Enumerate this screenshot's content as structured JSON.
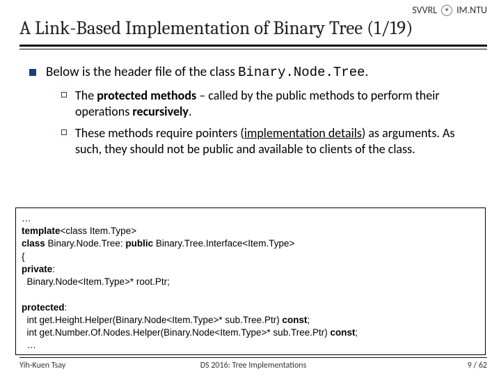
{
  "header": {
    "org_left": "SVVRL",
    "org_sep": "@",
    "org_right": "IM.NTU",
    "title": "A Link-Based Implementation of Binary Tree (1/19)"
  },
  "body": {
    "lvl1_pre": "Below is the header file of the class ",
    "lvl1_code": "Binary.Node.Tree",
    "lvl1_post": ".",
    "sub1_a": "The ",
    "sub1_b": "protected methods",
    "sub1_c": " – called by the public methods to perform their operations ",
    "sub1_d": "recursively",
    "sub1_e": ".",
    "sub2_a": "These methods require pointers (",
    "sub2_b": "implementation details",
    "sub2_c": ") as arguments. As such, they should not be public and available to clients of the class."
  },
  "code": {
    "l00": "…",
    "l01a": "template",
    "l01b": "<class Item.Type>",
    "l02a": "class ",
    "l02b": "Binary.Node.Tree: ",
    "l02c": "public ",
    "l02d": "Binary.Tree.Interface<Item.Type>",
    "l03": "{",
    "l04": "private",
    "l05": "  Binary.Node<Item.Type>* root.Ptr;",
    "blank": "",
    "l06": "protected",
    "l07a": "  int get.Height.Helper(Binary.Node<Item.Type>* sub.Tree.Ptr) ",
    "l07b": "const",
    "l08a": "  int get.Number.Of.Nodes.Helper(Binary.Node<Item.Type>* sub.Tree.Ptr) ",
    "l08b": "const",
    "l09": "  …",
    "colon": ":",
    "semi": ";"
  },
  "footer": {
    "author": "Yih-Kuen Tsay",
    "course": "DS 2016: Tree Implementations",
    "page": "9 / 62"
  }
}
